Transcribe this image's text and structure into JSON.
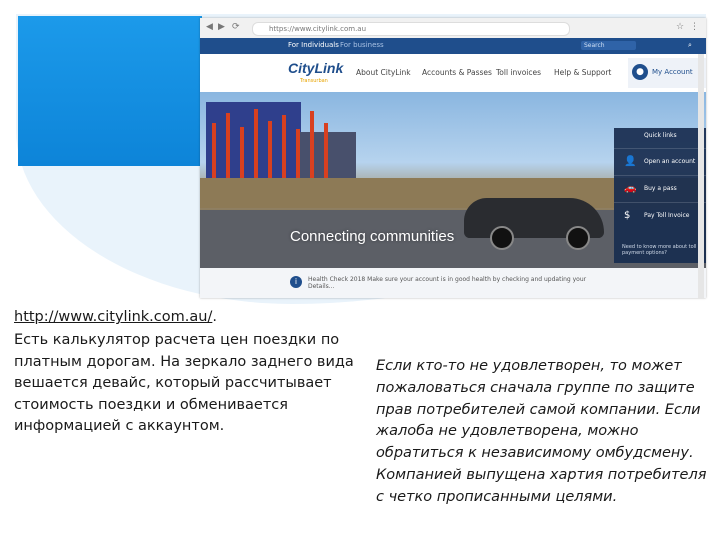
{
  "browser": {
    "url": "https://www.citylink.com.au",
    "topnav": {
      "tab1": "For Individuals",
      "tab2": "For business",
      "search": "Search"
    },
    "logo": {
      "name": "CityLink",
      "tagline": "Transurban"
    },
    "nav": [
      "About CityLink",
      "Accounts & Passes",
      "Toll invoices",
      "Help & Support"
    ],
    "account_label": "My Account",
    "hero_text": "Connecting communities",
    "quick_links": {
      "title": "Quick links",
      "items": [
        {
          "icon": "person-add-icon",
          "label": "Open an account"
        },
        {
          "icon": "car-icon",
          "label": "Buy a pass"
        },
        {
          "icon": "dollar-icon",
          "label": "Pay Toll Invoice"
        }
      ],
      "note": "Need to know more about toll payment options?"
    },
    "notice": "Health Check 2018 Make sure your account is in good health by checking and updating your Details..."
  },
  "caption": {
    "link_text": "http://www.citylink.com.au/",
    "link_suffix": ".",
    "left": "Есть калькулятор расчета цен поездки по платным дорогам. На зеркало заднего вида вешается девайс, который рассчитывает стоимость поездки и обменивается информацией с аккаунтом.",
    "right": "Если кто-то не удовлетворен, то может пожаловаться сначала группе по защите прав потребителей самой компании. Если жалоба не удовлетворена, можно обратиться к независимому омбудсмену. Компанией выпущена хартия потребителя с четко прописанными целями."
  },
  "colors": {
    "brand": "#1f4e8c",
    "accent": "#1c9aea"
  }
}
